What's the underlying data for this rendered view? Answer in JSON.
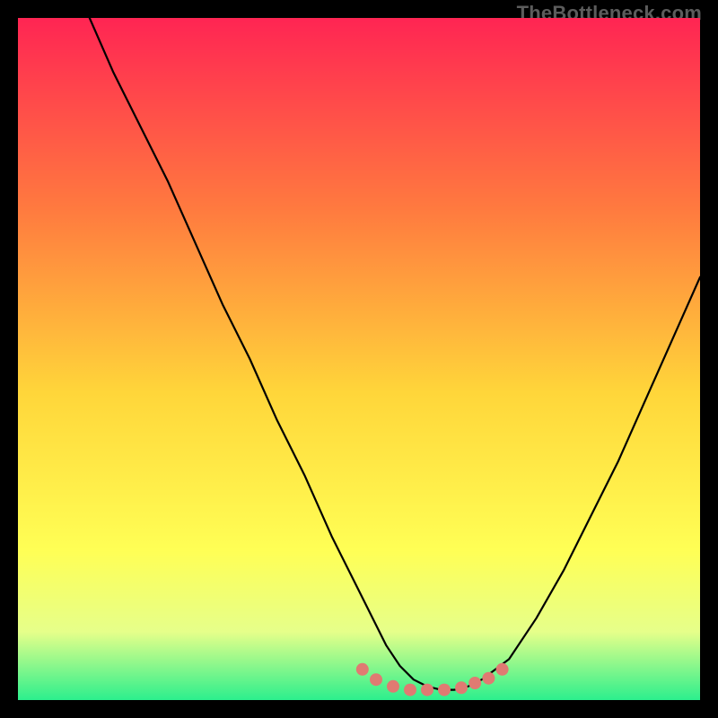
{
  "watermark": {
    "text": "TheBottleneck.com"
  },
  "colors": {
    "background": "#000000",
    "gradient_top": "#ff2553",
    "gradient_mid1": "#ff7a3f",
    "gradient_mid2": "#ffd63a",
    "gradient_mid3": "#ffff55",
    "gradient_mid4": "#e6ff8a",
    "gradient_bottom": "#2cef8d",
    "curve": "#000000",
    "marker_fill": "#e07a72",
    "marker_stroke": "#c9635b"
  },
  "chart_data": {
    "type": "line",
    "title": "",
    "xlabel": "",
    "ylabel": "",
    "xlim": [
      0,
      100
    ],
    "ylim": [
      0,
      100
    ],
    "series": [
      {
        "name": "bottleneck-curve",
        "x": [
          10.5,
          14,
          18,
          22,
          26,
          30,
          34,
          38,
          42,
          46,
          50,
          54,
          56,
          58,
          60,
          62,
          64,
          66,
          68,
          72,
          76,
          80,
          84,
          88,
          92,
          96,
          100
        ],
        "y": [
          100,
          92,
          84,
          76,
          67,
          58,
          50,
          41,
          33,
          24,
          16,
          8,
          5,
          3,
          2,
          1.5,
          1.5,
          2,
          3,
          6,
          12,
          19,
          27,
          35,
          44,
          53,
          62
        ]
      }
    ],
    "markers": {
      "name": "highlight-range",
      "x": [
        50.5,
        52.5,
        55,
        57.5,
        60,
        62.5,
        65,
        67,
        69,
        71
      ],
      "y": [
        4.5,
        3,
        2,
        1.5,
        1.5,
        1.5,
        1.8,
        2.5,
        3.2,
        4.5
      ]
    }
  }
}
